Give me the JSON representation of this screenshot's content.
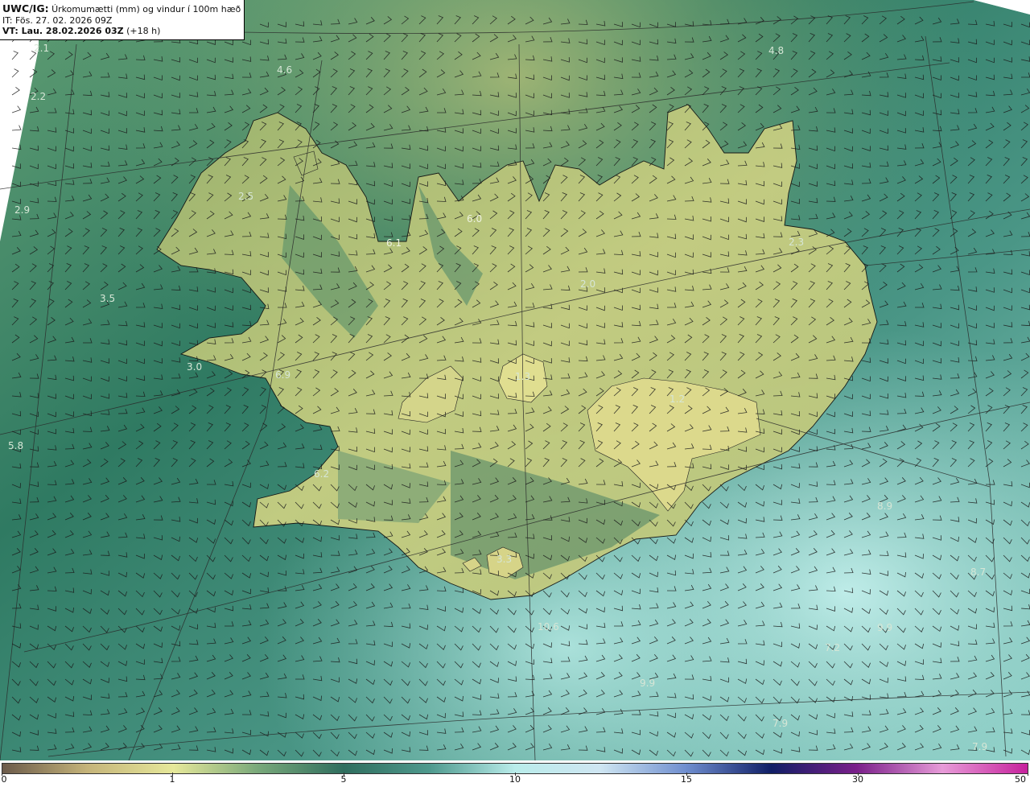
{
  "title": {
    "prefix": "UWC/IG:",
    "description": "Úrkomumætti (mm) og vindur í 100m hæð",
    "init_time": "IT: Fös. 27. 02. 2026 09Z",
    "valid_prefix": "VT: Lau. 28.02.2026 03Z",
    "valid_suffix": "(+18 h)"
  },
  "map_labels": [
    "2.1",
    "4.6",
    "4.8",
    "2.2",
    "2.9",
    "2.5",
    "6.0",
    "6.1",
    "2.3",
    "2.0",
    "3.5",
    "3.0",
    "6.9",
    "1.3",
    "1.2",
    "5.8",
    "6.2",
    "3.3",
    "8.9",
    "8.7",
    "10.6",
    "7.2",
    "9.9",
    "9.9",
    "7.9",
    "7.9"
  ],
  "colorbar": {
    "ticks": [
      "0",
      "1",
      "5",
      "10",
      "15",
      "30",
      "50"
    ],
    "colors": [
      "#6b5a4a",
      "#c5b47a",
      "#e6e89a",
      "#78a87a",
      "#2f6e5e",
      "#4f9a8e",
      "#b9ecea",
      "#cfe6f2",
      "#6f8ecf",
      "#101e66",
      "#7a1f8a",
      "#e79bd8",
      "#c6219c"
    ]
  }
}
